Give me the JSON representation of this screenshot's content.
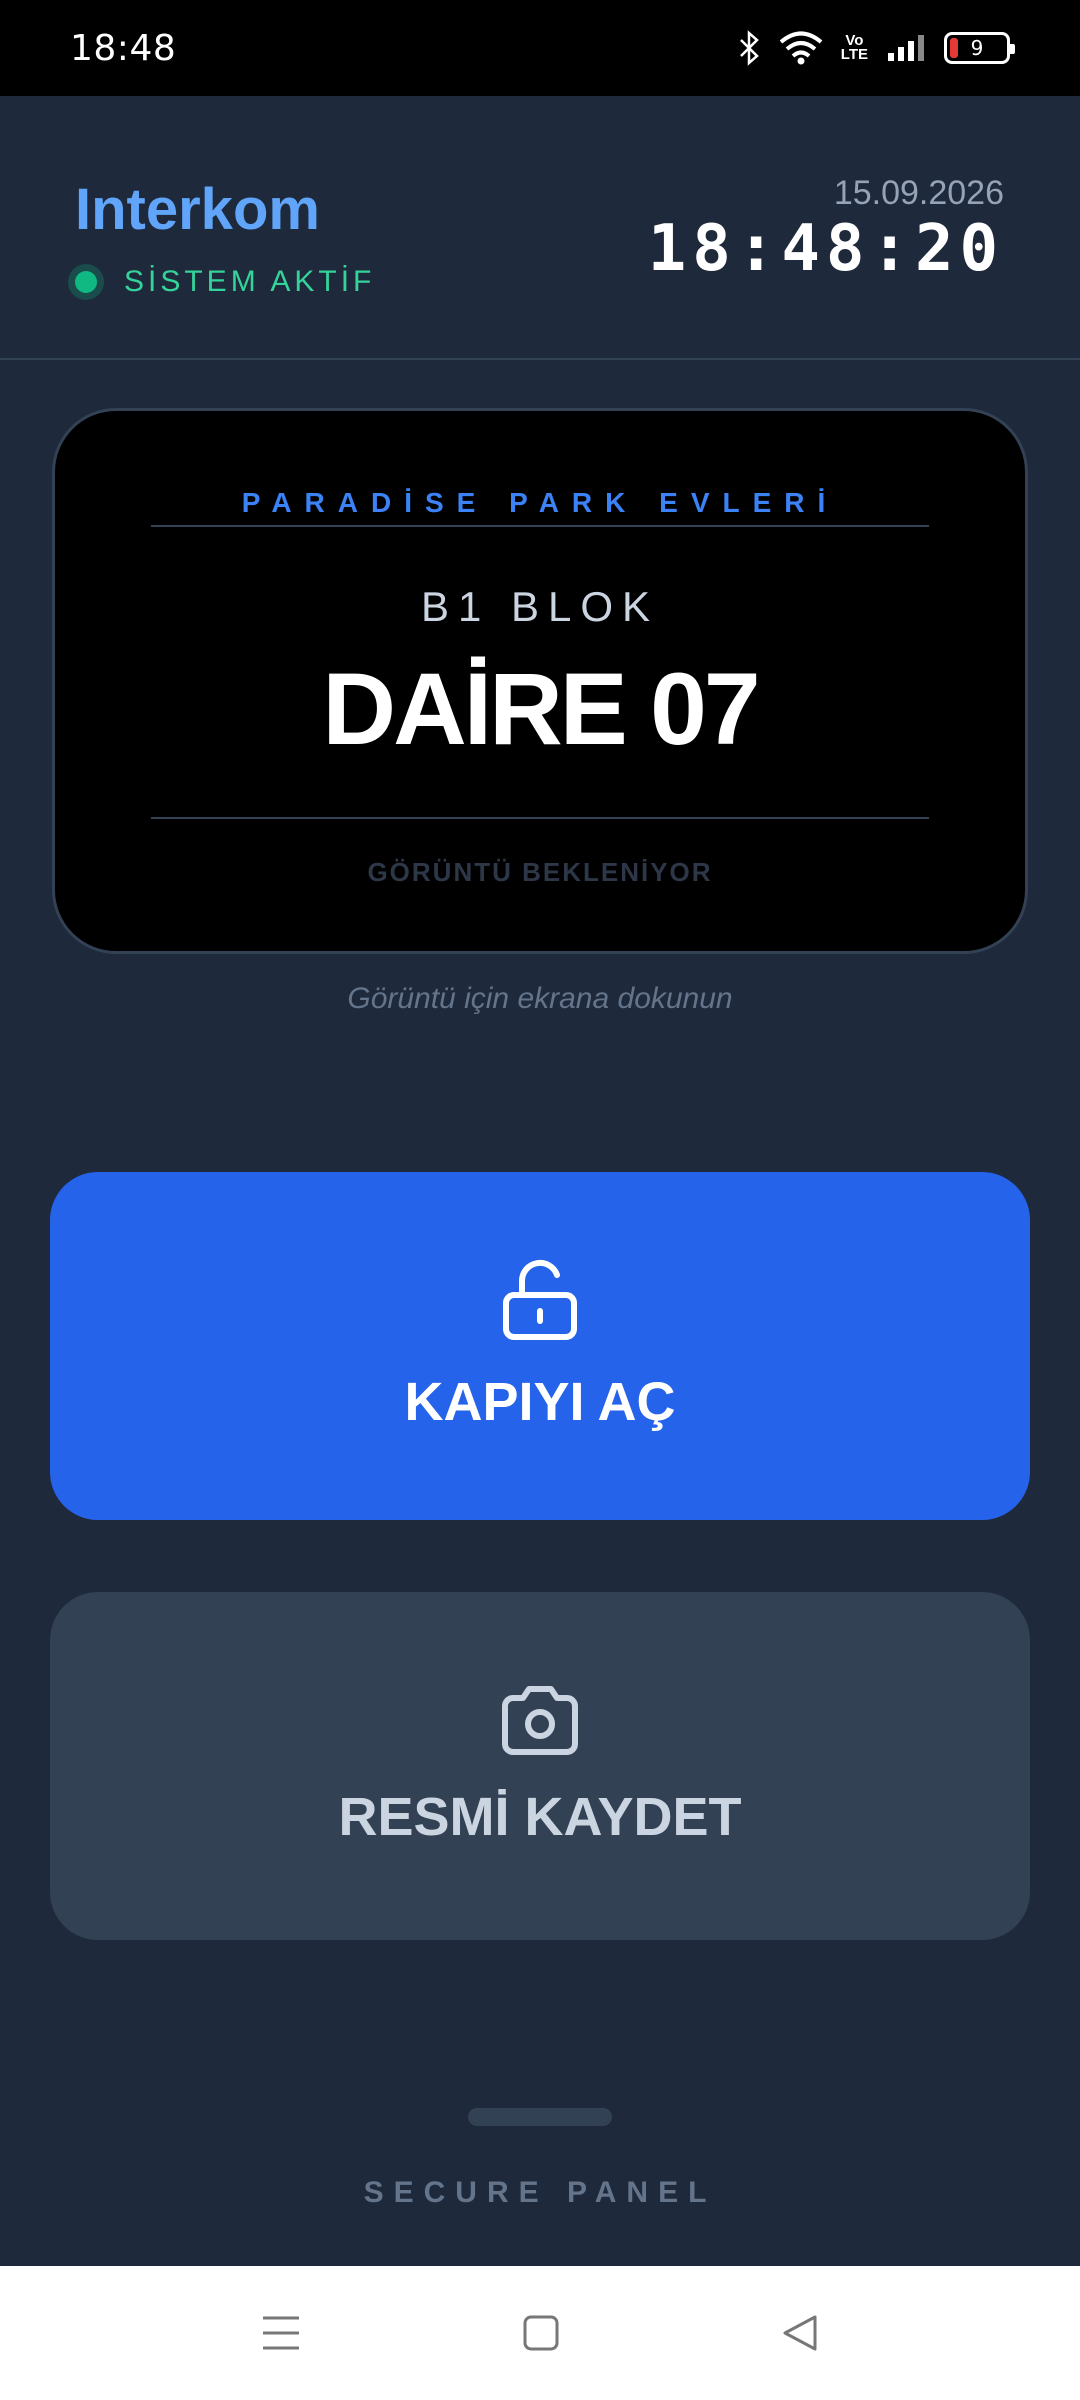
{
  "status_bar": {
    "time": "18:48",
    "battery": "9",
    "network": "LTE"
  },
  "header": {
    "title": "Interkom",
    "status": "SİSTEM AKTİF",
    "date": "15.09.2026",
    "clock": "18:48:20"
  },
  "video": {
    "complex_name": "PARADİSE PARK EVLERİ",
    "block": "B1 BLOK",
    "unit": "DAİRE 07",
    "waiting": "GÖRÜNTÜ BEKLENİYOR",
    "hint": "Görüntü için ekrana dokunun"
  },
  "actions": {
    "open_door": {
      "label": "KAPIYI AÇ",
      "icon": "unlock-icon"
    },
    "save_image": {
      "label": "RESMİ KAYDET",
      "icon": "camera-icon"
    }
  },
  "footer": {
    "label": "SECURE PANEL"
  },
  "colors": {
    "background": "#1e293b",
    "accent": "#2563eb",
    "title": "#60a5fa",
    "status": "#10b981"
  }
}
